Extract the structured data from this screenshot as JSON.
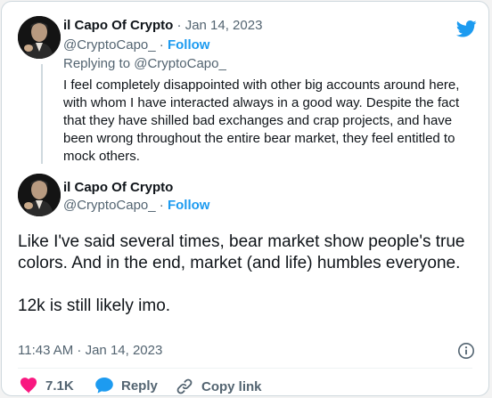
{
  "colors": {
    "twitter_blue": "#1d9bf0",
    "like_red": "#f91880",
    "muted_text": "#536471",
    "border": "#cfd9de"
  },
  "parent_tweet": {
    "display_name": "il Capo Of Crypto",
    "separator": "·",
    "date": "Jan 14, 2023",
    "handle": "@CryptoCapo_",
    "follow_label": "Follow",
    "replying_to_prefix": "Replying to",
    "replying_to_handle": "@CryptoCapo_",
    "text": "I feel completely disappointed with other big accounts around here, with whom I have interacted always in a good way. Despite the fact that they have shilled bad exchanges and crap projects, and have been wrong throughout the entire bear market, they feel entitled to mock others."
  },
  "main_tweet": {
    "display_name": "il Capo Of Crypto",
    "handle": "@CryptoCapo_",
    "separator": "·",
    "follow_label": "Follow",
    "paragraph_1": "Like I've said several times, bear market show people's true colors. And in the end, market (and life) humbles everyone.",
    "paragraph_2": "12k is still likely imo.",
    "timestamp": "11:43 AM · Jan 14, 2023"
  },
  "actions": {
    "like_count": "7.1K",
    "reply_label": "Reply",
    "copy_link_label": "Copy link"
  },
  "icons": {
    "brand": "twitter-bird-icon",
    "info": "info-icon",
    "like": "heart-icon",
    "reply": "speech-bubble-icon",
    "copy_link": "link-icon"
  }
}
